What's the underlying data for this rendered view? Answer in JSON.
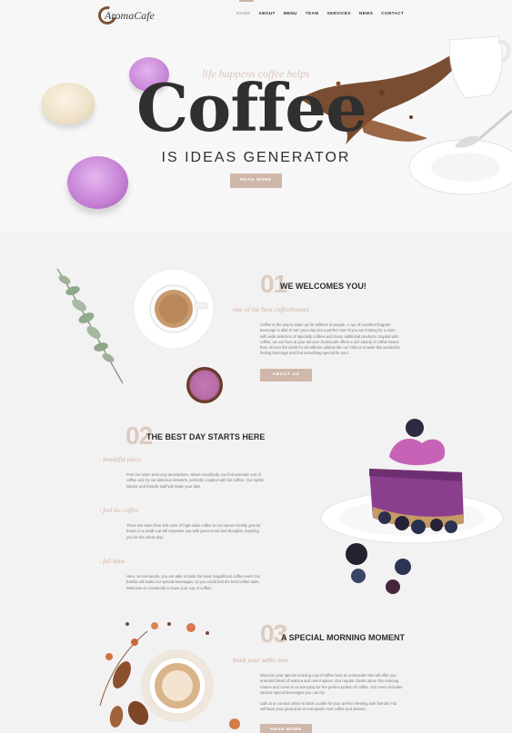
{
  "brand": {
    "logo_text": "AromaCafe"
  },
  "nav": {
    "items": [
      {
        "label": "HOME",
        "active": true
      },
      {
        "label": "ABOUT"
      },
      {
        "label": "MENU"
      },
      {
        "label": "TEAM"
      },
      {
        "label": "SERVICES"
      },
      {
        "label": "NEWS"
      },
      {
        "label": "CONTACT"
      }
    ]
  },
  "hero": {
    "tagline": "life happens coffee helps",
    "title": "Coffee",
    "subtitle": "IS IDEAS GENERATOR",
    "button_label": "READ MORE"
  },
  "section1": {
    "number": "01",
    "title": "WE WELCOMES YOU!",
    "subtitle": "one of the best coffeehouses",
    "text": "Coffee is the way to wake up for millions of people. A cup of excellent fragrant beverage is able to turn your day into a perfect one! If you are looking for a store with wide selection of specialty coffees and many additional products coupled with coffee, we are here at your service! Aromacafe offers a rich variety of coffee beans from all over the world for all caffeine addicts like us! Visit us to taste this wonderful feeling beverage and find something special for you!",
    "button_label": "ABOUT US"
  },
  "section2": {
    "number": "02",
    "title": "THE BEST DAY STARTS HERE",
    "features": [
      {
        "title": "- beautiful place",
        "text": "Feel our warm and cozy atmosphere, where everybody can find aromatic sort of coffee and try our delicious desserts, perfectly coupled with hot coffee. Our stylish interior and friendly staff will make your day!"
      },
      {
        "title": "- feel the coffee",
        "text": "There are more than 100 sorts of high-class coffee in our menu! Freshly ground beans in a small cup will empower you with great mood and thoughts, inspiring you for the whole day."
      },
      {
        "title": "- full taste",
        "text": "Here, at Aromacafe, you are able to taste the most magnificent coffee ever! Our barista will make our special beverages, so you could feel the best coffee taste. Welcome to Aromacafe to have your cup of coffee!"
      }
    ]
  },
  "section3": {
    "number": "03",
    "title": "A SPECIAL MORNING MOMENT",
    "subtitle": "book your table now",
    "text1": "Discover your special morning cup of coffee here at Aromacafe! We will offer you aromatic blend of arabica and orient spices. Our regular clients adore this morning routine and come to us everyday for the perfect portion of coffee. Our menu includes various special beverages you can try!",
    "text2": "Call us or contact online to book a table for your perfect meeting with friends! You will have your great time at Aromacafe over coffee and dessert.",
    "button_label": "READ MORE"
  },
  "colors": {
    "accent": "#cfb8a9",
    "number": "#dccbbf",
    "subtitle": "#cdb0a0",
    "dark": "#2f2f2f",
    "macaron_pink": "#c27fd0"
  }
}
